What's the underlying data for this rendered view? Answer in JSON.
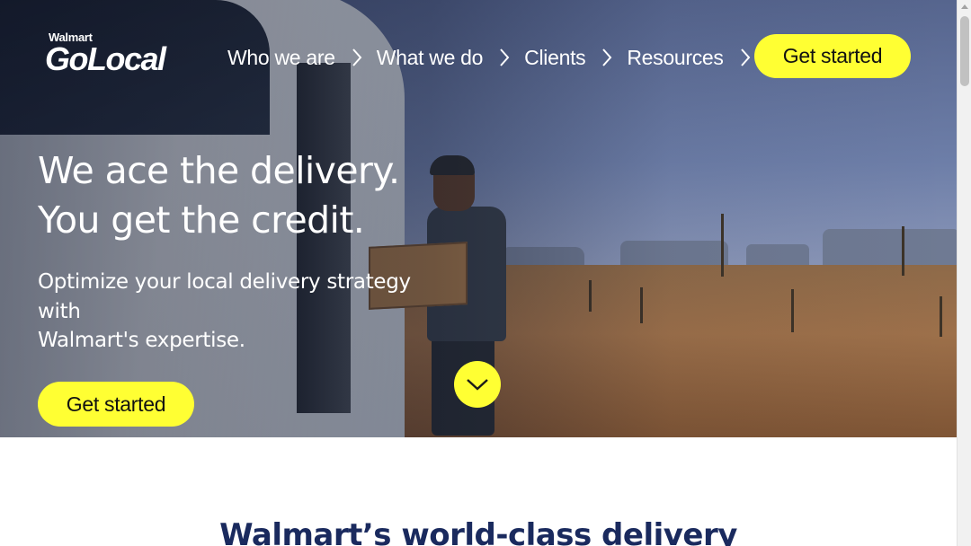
{
  "brand": {
    "parent": "Walmart",
    "name": "GoLocal"
  },
  "nav": {
    "items": [
      {
        "label": "Who we are",
        "icon": "chevron-right-icon"
      },
      {
        "label": "What we do",
        "icon": "chevron-right-icon"
      },
      {
        "label": "Clients",
        "icon": "chevron-right-icon"
      },
      {
        "label": "Resources",
        "icon": "chevron-right-icon"
      }
    ],
    "cta_label": "Get started"
  },
  "hero": {
    "headline_line1": "We ace the delivery.",
    "headline_line2": "You get the credit.",
    "subhead_line1": "Optimize your local delivery strategy",
    "subhead_line2": "with",
    "subhead_line3": "Walmart's expertise.",
    "cta_label": "Get started",
    "scroll_icon": "chevron-down-icon"
  },
  "section": {
    "title": "Walmart’s world-class delivery"
  },
  "colors": {
    "accent": "#ffff33",
    "heading": "#1a2a5e"
  }
}
